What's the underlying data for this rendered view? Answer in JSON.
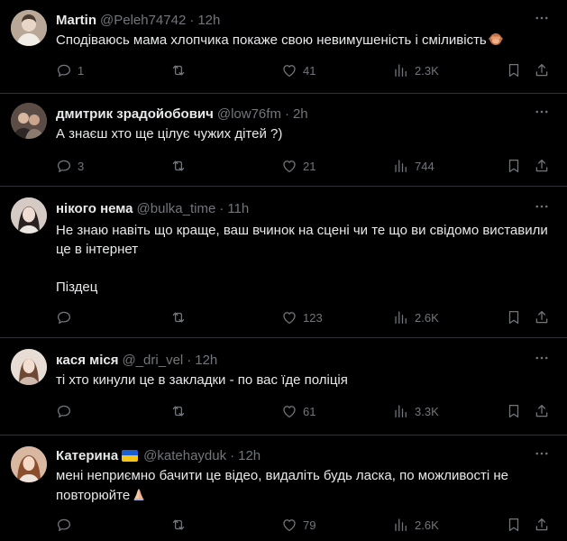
{
  "replies": [
    {
      "name": "Martin",
      "handle": "@Peleh74742",
      "time": "12h",
      "text": "Сподіваюсь мама хлопчика покаже свою невимушеність і сміливість",
      "emoji": "see-no-evil-monkey-icon",
      "replies": "1",
      "retweets": "",
      "likes": "41",
      "views": "2.3K",
      "avatar_color": "#c9b8a8"
    },
    {
      "name": "дмитрик зрадойобович",
      "handle": "@low76fm",
      "time": "2h",
      "text": "А знаєш хто ще цілує чужих дітей ?)",
      "replies": "3",
      "retweets": "",
      "likes": "21",
      "views": "744",
      "avatar_color": "#6b5a50"
    },
    {
      "name": "нікого нема",
      "handle": "@bulka_time",
      "time": "11h",
      "text": "Не знаю навіть що краще, ваш вчинок на сцені чи те що ви свідомо виставили це в інтернет\n\nПіздец",
      "replies": "",
      "retweets": "",
      "likes": "123",
      "views": "2.6K",
      "avatar_color": "#d9cfc8"
    },
    {
      "name": "кася міся",
      "handle": "@_dri_vel",
      "time": "12h",
      "text": "ті хто кинули це в закладки - по вас їде поліція",
      "replies": "",
      "retweets": "",
      "likes": "61",
      "views": "3.3K",
      "avatar_color": "#e3d2c4"
    },
    {
      "name": "Катерина",
      "handle": "@katehayduk",
      "time": "12h",
      "text": "мені неприємно бачити це відео, видаліть будь ласка, по можливості не повторюйте",
      "emoji": "folded-hands-icon",
      "replies": "",
      "retweets": "",
      "likes": "79",
      "views": "2.6K",
      "avatar_color": "#b8866b"
    }
  ],
  "colors": {
    "background": "#000000",
    "text": "#e7e9ea",
    "muted": "#71767b",
    "divider": "#2f3336"
  }
}
